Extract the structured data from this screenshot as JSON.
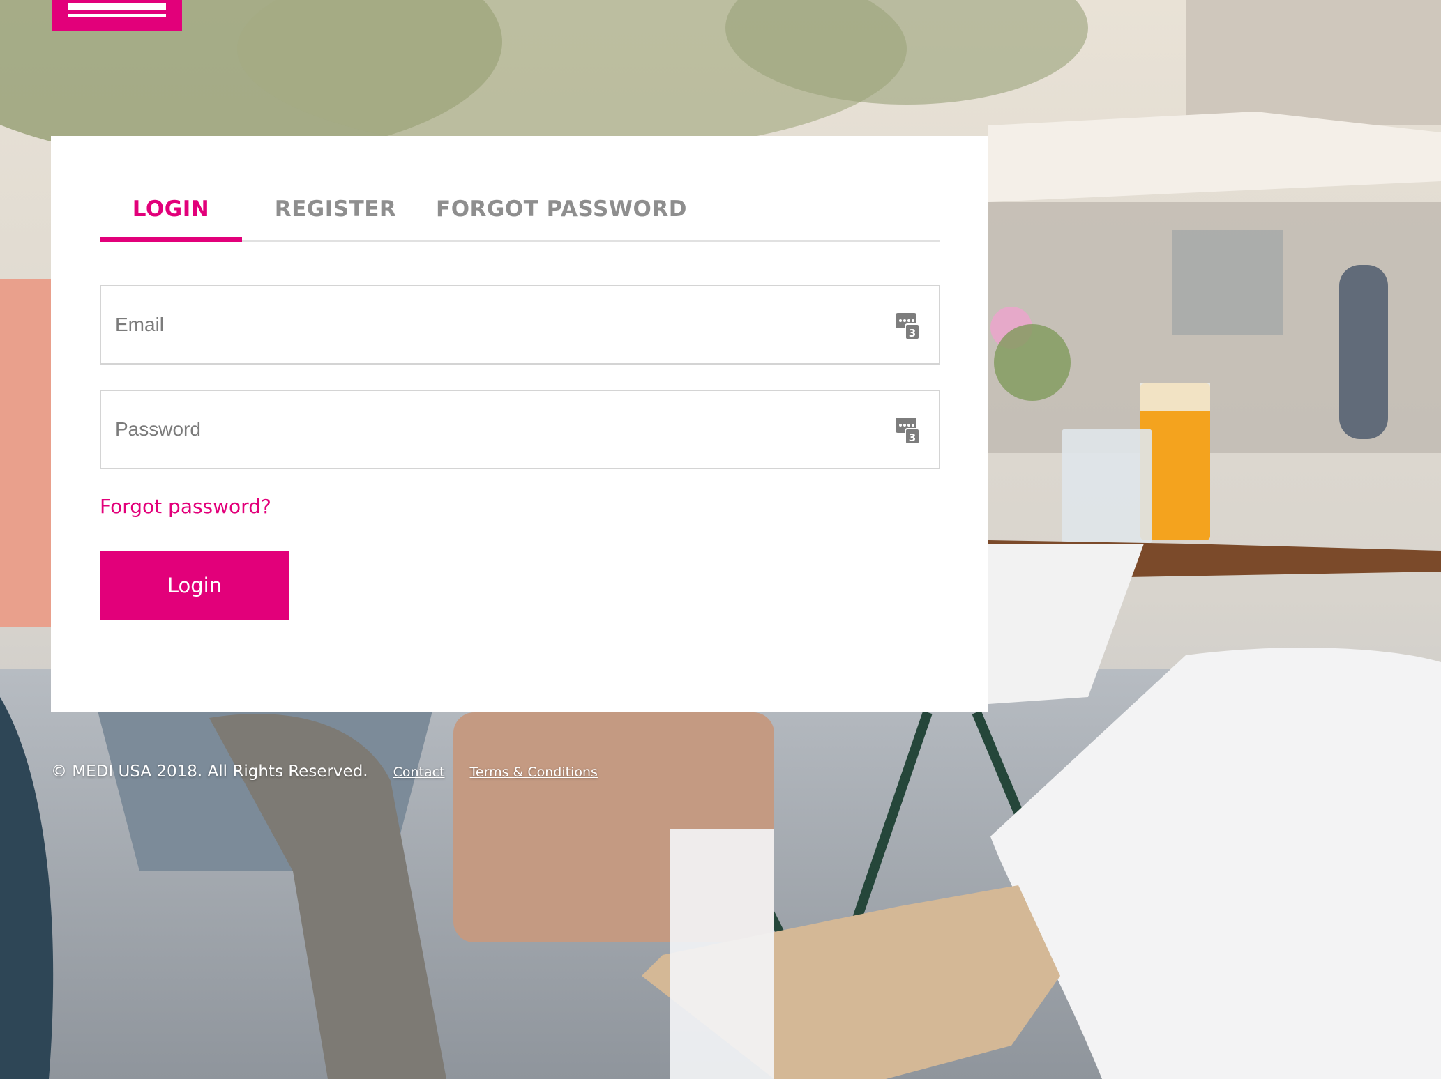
{
  "brand": {
    "accent_color": "#e2007a"
  },
  "tabs": [
    {
      "label": "LOGIN",
      "active": true
    },
    {
      "label": "REGISTER",
      "active": false
    },
    {
      "label": "FORGOT PASSWORD",
      "active": false
    }
  ],
  "form": {
    "email_placeholder": "Email",
    "password_placeholder": "Password",
    "field_icon": "password-manager-icon",
    "forgot_link": "Forgot password?",
    "login_button": "Login"
  },
  "footer": {
    "copyright": "© MEDI USA 2018. All Rights Reserved.",
    "links": [
      "Contact",
      "Terms & Conditions"
    ]
  }
}
